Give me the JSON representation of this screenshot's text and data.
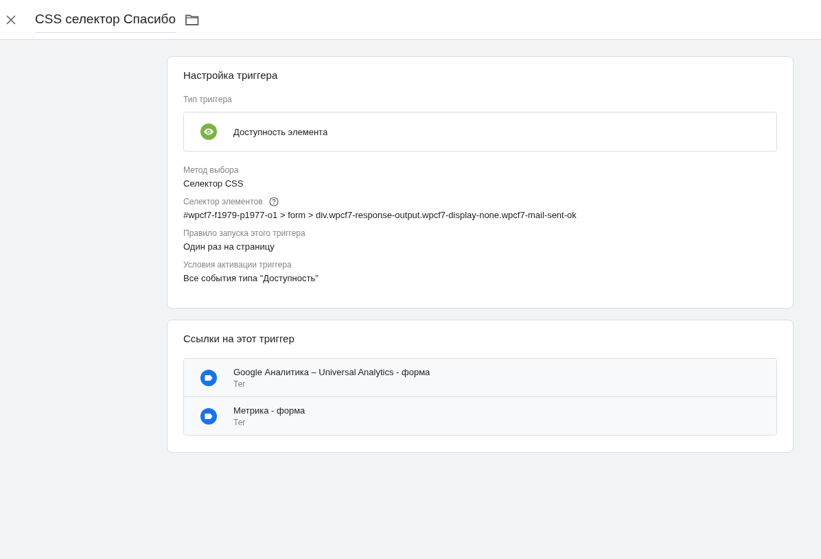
{
  "header": {
    "title": "CSS селектор Спасибо"
  },
  "config_card": {
    "title": "Настройка триггера",
    "type_label": "Тип триггера",
    "trigger_type": "Доступность элемента",
    "fields": [
      {
        "label": "Метод выбора",
        "value": "Селектор CSS",
        "help": false
      },
      {
        "label": "Селектор элементов",
        "value": "#wpcf7-f1979-p1977-o1 > form > div.wpcf7-response-output.wpcf7-display-none.wpcf7-mail-sent-ok",
        "help": true
      },
      {
        "label": "Правило запуска этого триггера",
        "value": "Один раз на страницу",
        "help": false
      },
      {
        "label": "Условия активации триггера",
        "value": "Все события типа \"Доступность\"",
        "help": false
      }
    ]
  },
  "references_card": {
    "title": "Ссылки на этот триггер",
    "items": [
      {
        "name": "Google Аналитика – Universal Analytics - форма",
        "type": "Тег"
      },
      {
        "name": "Метрика - форма",
        "type": "Тег"
      }
    ]
  }
}
